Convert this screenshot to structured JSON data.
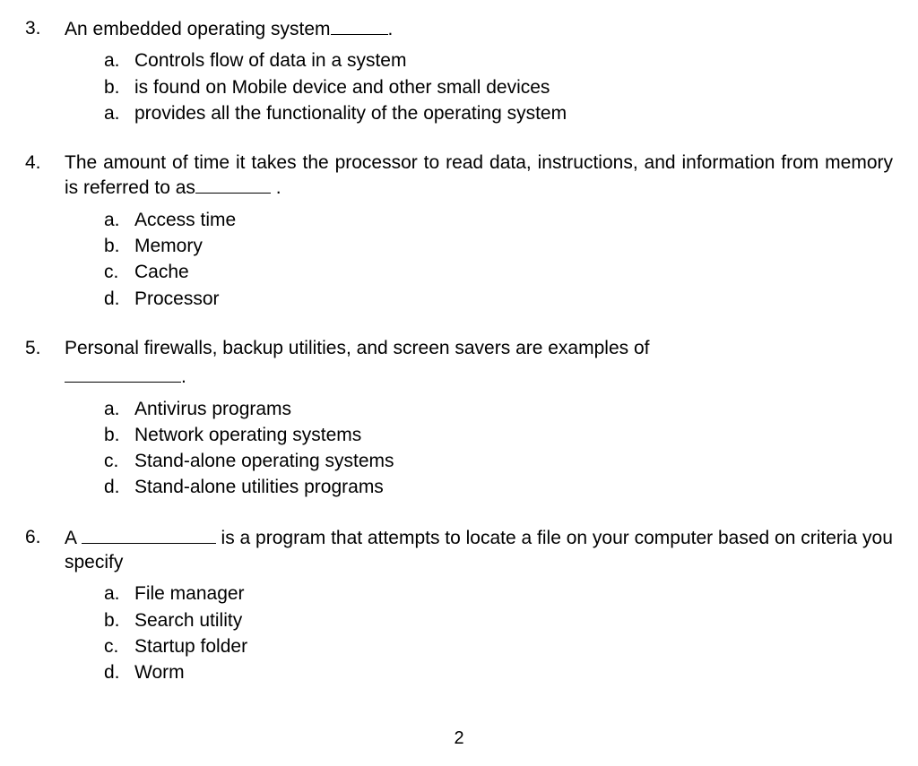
{
  "questions": [
    {
      "number": "3.",
      "text_before": "An embedded operating system",
      "text_after": ".",
      "options": [
        {
          "letter": "a.",
          "text": "Controls flow of data in a system"
        },
        {
          "letter": "b.",
          "text": "is found on Mobile device and other small devices"
        },
        {
          "letter": "a.",
          "text": "provides all the functionality of the operating system"
        }
      ]
    },
    {
      "number": "4.",
      "text_before": "The amount of time it takes the processor to read data, instructions, and information from memory is referred to as",
      "text_after": " .",
      "options": [
        {
          "letter": "a.",
          "text": "Access time"
        },
        {
          "letter": "b.",
          "text": "Memory"
        },
        {
          "letter": "c.",
          "text": "Cache"
        },
        {
          "letter": "d.",
          "text": "Processor"
        }
      ]
    },
    {
      "number": "5.",
      "text_before": "Personal firewalls, backup utilities, and screen savers are examples of",
      "text_after": ".",
      "options": [
        {
          "letter": "a.",
          "text": "Antivirus programs"
        },
        {
          "letter": "b.",
          "text": "Network operating systems"
        },
        {
          "letter": "c.",
          "text": "Stand-alone operating systems"
        },
        {
          "letter": "d.",
          "text": "Stand-alone utilities programs"
        }
      ]
    },
    {
      "number": "6.",
      "text_before": "A ",
      "text_after": " is a program that attempts to locate a file on your computer based on criteria you specify",
      "options": [
        {
          "letter": "a.",
          "text": "File manager"
        },
        {
          "letter": "b.",
          "text": "Search utility"
        },
        {
          "letter": "c.",
          "text": "Startup folder"
        },
        {
          "letter": "d.",
          "text": "Worm"
        }
      ]
    }
  ],
  "page_number": "2"
}
